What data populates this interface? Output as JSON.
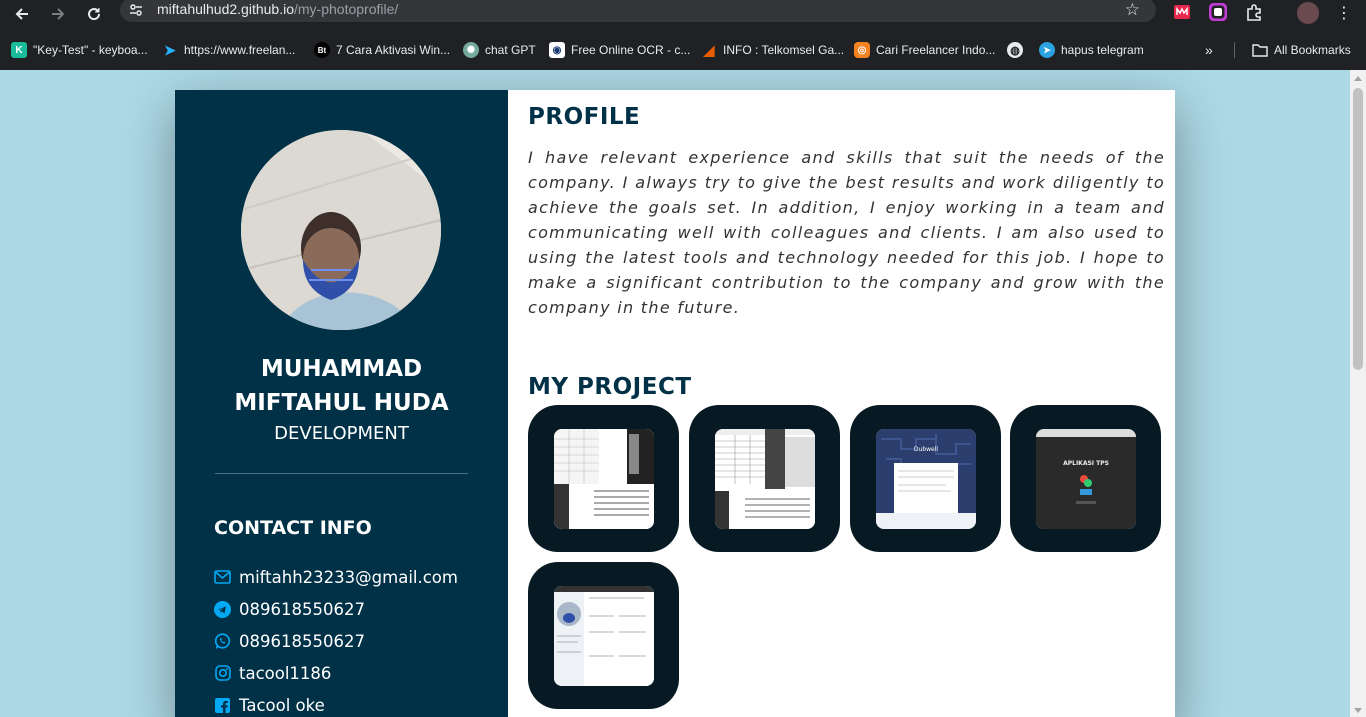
{
  "browser": {
    "url_host": "miftahulhud2.github.io",
    "url_path": "/my-photoprofile/",
    "bookmarks": [
      {
        "label": "\"Key-Test\" - keyboa...",
        "icon": "keytest-icon",
        "color": "#1abc9c",
        "glyph": "K"
      },
      {
        "label": "https://www.freelan...",
        "icon": "freelancer-icon",
        "color": "#29b2fe",
        "glyph": "➤"
      },
      {
        "label": "7 Cara Aktivasi Win...",
        "icon": "bt-icon",
        "color": "#000000",
        "glyph": "Bt"
      },
      {
        "label": "chat GPT",
        "icon": "chatgpt-icon",
        "color": "#74aa9c",
        "glyph": "✺"
      },
      {
        "label": "Free Online OCR - c...",
        "icon": "ocr-icon",
        "color": "#ffffff",
        "glyph": "▤"
      },
      {
        "label": "INFO : Telkomsel Ga...",
        "icon": "telkomsel-icon",
        "color": "#e60000",
        "glyph": "◢"
      },
      {
        "label": "Cari Freelancer Indo...",
        "icon": "sribulancer-icon",
        "color": "#f58220",
        "glyph": "◎"
      },
      {
        "label": "",
        "icon": "globe-icon",
        "color": "#e8eaed",
        "glyph": "◍"
      },
      {
        "label": "hapus telegram",
        "icon": "telegram-icon",
        "color": "#2aa3e0",
        "glyph": "➤"
      }
    ],
    "all_bookmarks": "All Bookmarks"
  },
  "profile": {
    "name_line1": "MUHAMMAD",
    "name_line2": "MIFTAHUL HUDA",
    "role": "DEVELOPMENT",
    "contact_title": "CONTACT INFO",
    "contacts": [
      {
        "icon": "email-icon",
        "text": "miftahh23233@gmail.com"
      },
      {
        "icon": "telegram-icon",
        "text": "089618550627"
      },
      {
        "icon": "whatsapp-icon",
        "text": "089618550627"
      },
      {
        "icon": "instagram-icon",
        "text": "tacool1186"
      },
      {
        "icon": "facebook-icon",
        "text": "Tacool oke"
      }
    ]
  },
  "main": {
    "profile_heading": "PROFILE",
    "profile_text": "I have relevant experience and skills that suit the needs of the company. I always try to give the best results and work diligently to achieve the goals set. In addition, I enjoy working in a team and communicating well with colleagues and clients. I am also used to using the latest tools and technology needed for this job. I hope to make a significant contribution to the company and grow with the company in the future.",
    "project_heading": "MY PROJECT",
    "projects": [
      {
        "thumb": "spreadsheet-document-thumbnail"
      },
      {
        "thumb": "spreadsheet-list-thumbnail"
      },
      {
        "thumb": "blue-pattern-article-thumbnail"
      },
      {
        "thumb": "aplikasi-tps-dark-thumbnail",
        "caption": "APLIKASI TPS"
      },
      {
        "thumb": "photoprofile-page-thumbnail"
      }
    ]
  },
  "colors": {
    "sidebar": "#003147",
    "background": "#add8e6",
    "heading": "#003147",
    "project_tile": "#071a23",
    "contact_icon": "#03a9f4"
  }
}
